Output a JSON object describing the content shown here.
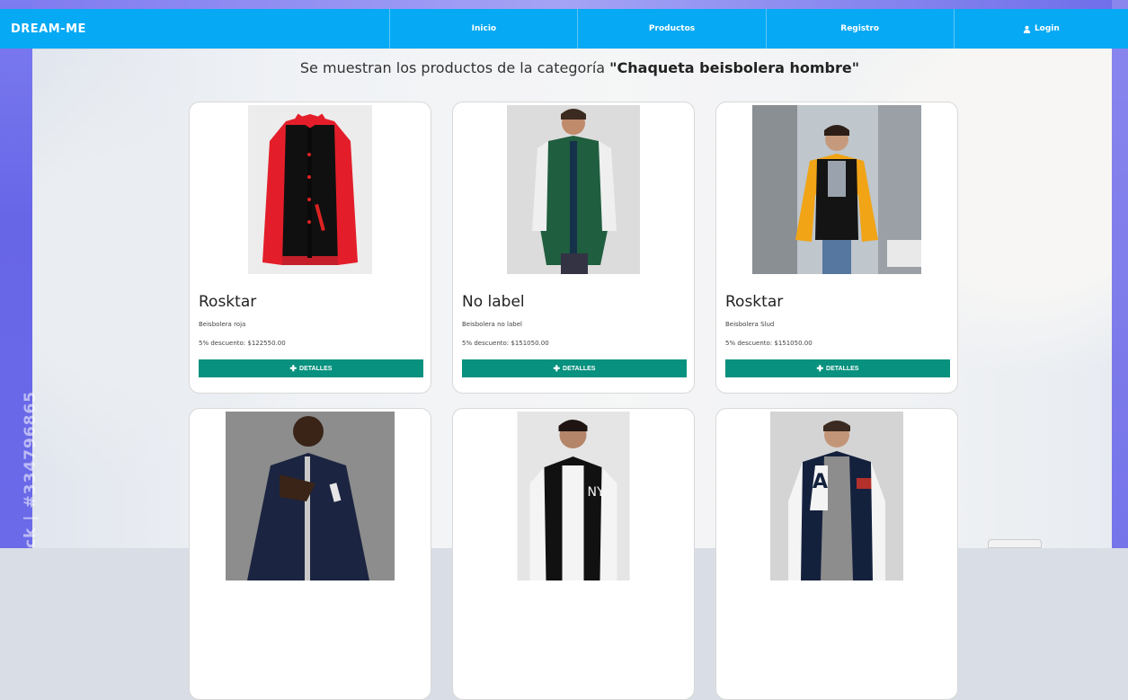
{
  "navbar": {
    "brand": "DREAM-ME",
    "links": [
      "Inicio",
      "Productos",
      "Registro"
    ],
    "login": "Login"
  },
  "heading": {
    "prefix": "Se muestran los productos de la categoría ",
    "category": "\"Chaqueta beisbolera hombre\""
  },
  "products": [
    {
      "brand": "Rosktar",
      "description": "Beisbolera roja",
      "discount": "5% descuento: $122550.00",
      "button": "DETALLES",
      "colors": {
        "body": "#111",
        "sleeve": "#e02428"
      }
    },
    {
      "brand": "No label",
      "description": "Beisbolera no label",
      "discount": "5% descuento: $151050.00",
      "button": "DETALLES",
      "colors": {
        "body": "#1f5e3f",
        "sleeve": "#f2f2f2"
      }
    },
    {
      "brand": "Rosktar",
      "description": "Beisbolera Slud",
      "discount": "5% descuento: $151050.00",
      "button": "DETALLES",
      "colors": {
        "body": "#111",
        "sleeve": "#f2a91b"
      }
    },
    {
      "brand": "",
      "description": "",
      "discount": "",
      "button": "",
      "colors": {
        "body": "#1b2440",
        "sleeve": "#1b2440"
      }
    },
    {
      "brand": "",
      "description": "",
      "discount": "",
      "button": "",
      "colors": {
        "body": "#111",
        "sleeve": "#f4f4f4"
      }
    },
    {
      "brand": "",
      "description": "",
      "discount": "",
      "button": "",
      "colors": {
        "body": "#14213d",
        "sleeve": "#f2f2f2"
      }
    }
  ],
  "watermark": "ck | #334796865",
  "theme": {
    "navbar": "#06a9f4",
    "button": "#07917e"
  }
}
